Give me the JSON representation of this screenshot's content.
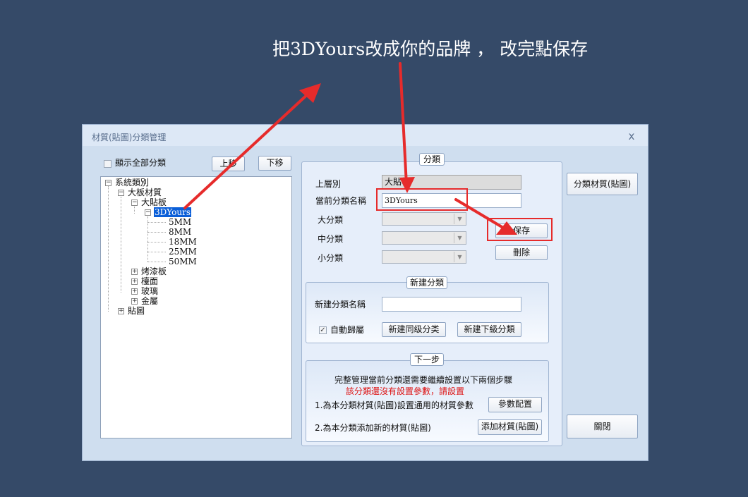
{
  "caption": "把3DYours改成你的品牌 ， 改完點保存",
  "window": {
    "title": "材質(貼圖)分類管理",
    "close": "x"
  },
  "left": {
    "show_all_label": "顯示全部分類",
    "up_button": "上移",
    "down_button": "下移",
    "tree": {
      "root": "系統類別",
      "board": "大板材質",
      "sticker_board": "大貼板",
      "selected": "3DYours",
      "sizes": [
        "5MM",
        "8MM",
        "18MM",
        "25MM",
        "50MM"
      ],
      "paint_board": "烤漆板",
      "countertop": "檯面",
      "glass": "玻璃",
      "metal": "金屬",
      "sticker": "貼圖"
    }
  },
  "category": {
    "caption": "分類",
    "parent_label": "上層別",
    "parent_value": "大貼板",
    "current_name_label": "當前分類名稱",
    "current_name_value": "3DYours",
    "major_label": "大分類",
    "middle_label": "中分類",
    "minor_label": "小分類",
    "save_button": "保存",
    "delete_button": "刪除"
  },
  "new_category": {
    "caption": "新建分類",
    "name_label": "新建分類名稱",
    "name_value": "",
    "auto_label": "自動歸屬",
    "auto_checked": true,
    "sibling_button": "新建同级分类",
    "child_button": "新建下級分類"
  },
  "next_step": {
    "caption": "下一步",
    "line1": "完整管理當前分類還需要繼續設置以下兩個步驟",
    "warning": "該分類還沒有設置參數，請設置",
    "step1": "1.為本分類材質(貼圖)設置通用的材質參數",
    "step1_button": "參數配置",
    "step2": "2.為本分類添加新的材質(貼圖)",
    "step2_button": "添加材質(貼圖)"
  },
  "right": {
    "classify_button": "分類材質(貼圖)",
    "close_button": "關閉"
  },
  "colors": {
    "background": "#354a68",
    "annotation": "#e62b2b",
    "selection": "#0b5fd8"
  }
}
